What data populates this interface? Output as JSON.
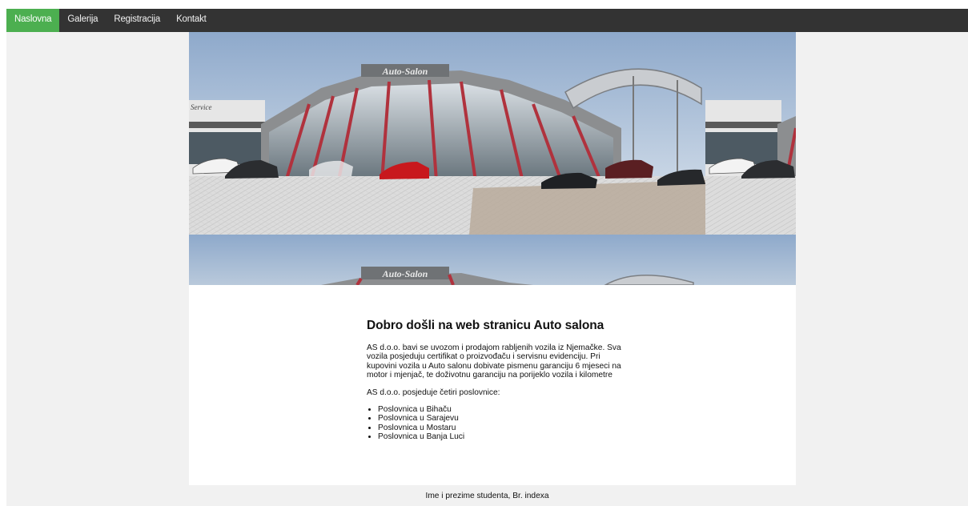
{
  "nav": {
    "items": [
      {
        "label": "Naslovna",
        "active": true
      },
      {
        "label": "Galerija",
        "active": false
      },
      {
        "label": "Registracija",
        "active": false
      },
      {
        "label": "Kontakt",
        "active": false
      }
    ]
  },
  "hero": {
    "sign_text": "Auto-Salon",
    "building_label": "Service"
  },
  "main": {
    "heading": "Dobro došli na web stranicu Auto salona",
    "intro": "AS d.o.o. bavi se uvozom i prodajom rabljenih vozila iz Njemačke. Sva vozila posjeduju certifikat o proizvođaču i servisnu evidenciju. Pri kupovini vozila u Auto salonu dobivate pismenu garanciju 6 mjeseci na motor i mjenjač, te doživotnu garanciju na porijeklo vozila i kilometre",
    "offices_intro": "AS d.o.o. posjeduje četiri poslovnice:",
    "offices": [
      "Poslovnica u Bihaču",
      "Poslovnica u Sarajevu",
      "Poslovnica u Mostaru",
      "Poslovnica u Banja Luci"
    ]
  },
  "footer": {
    "text": "Ime i prezime studenta, Br. indexa"
  },
  "colors": {
    "nav_bg": "#333333",
    "nav_active": "#4caf50",
    "page_bg": "#f1f1f1",
    "frame_red": "#b0323d",
    "sky": "#a9bfd8"
  }
}
